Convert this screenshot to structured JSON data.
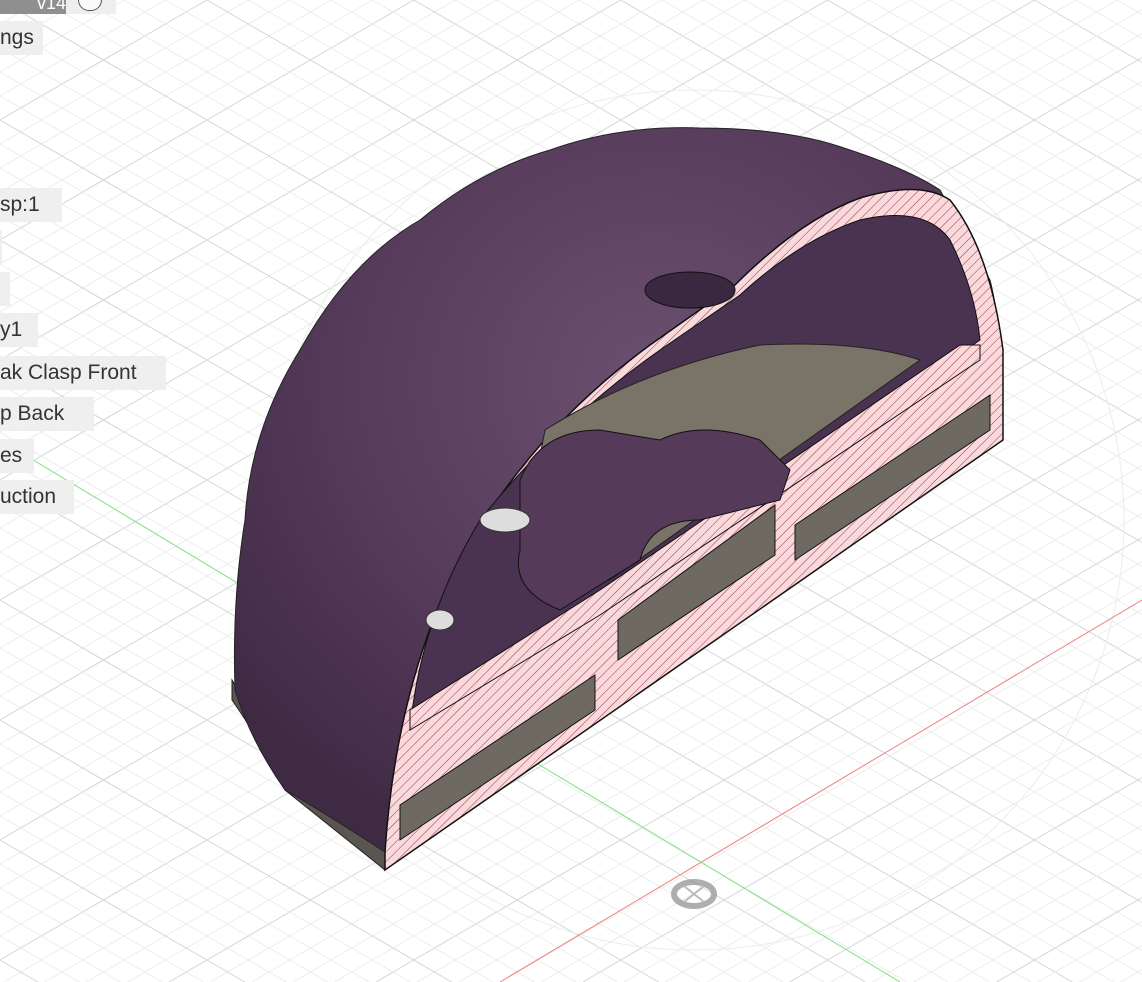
{
  "browser": {
    "version": "v14",
    "items": [
      {
        "label": "ngs"
      },
      {
        "label": "sp:1"
      },
      {
        "label": ""
      },
      {
        "label": ""
      },
      {
        "label": "y1"
      },
      {
        "label": "ak Clasp Front"
      },
      {
        "label": "p Back"
      },
      {
        "label": "es"
      },
      {
        "label": "uction"
      }
    ]
  },
  "viewport": {
    "model_color": "#553a5a",
    "section_color": "#f7d5d8",
    "axis_x_color": "#f08080",
    "axis_y_color": "#80e080",
    "origin_icon": "origin-marker-icon"
  }
}
